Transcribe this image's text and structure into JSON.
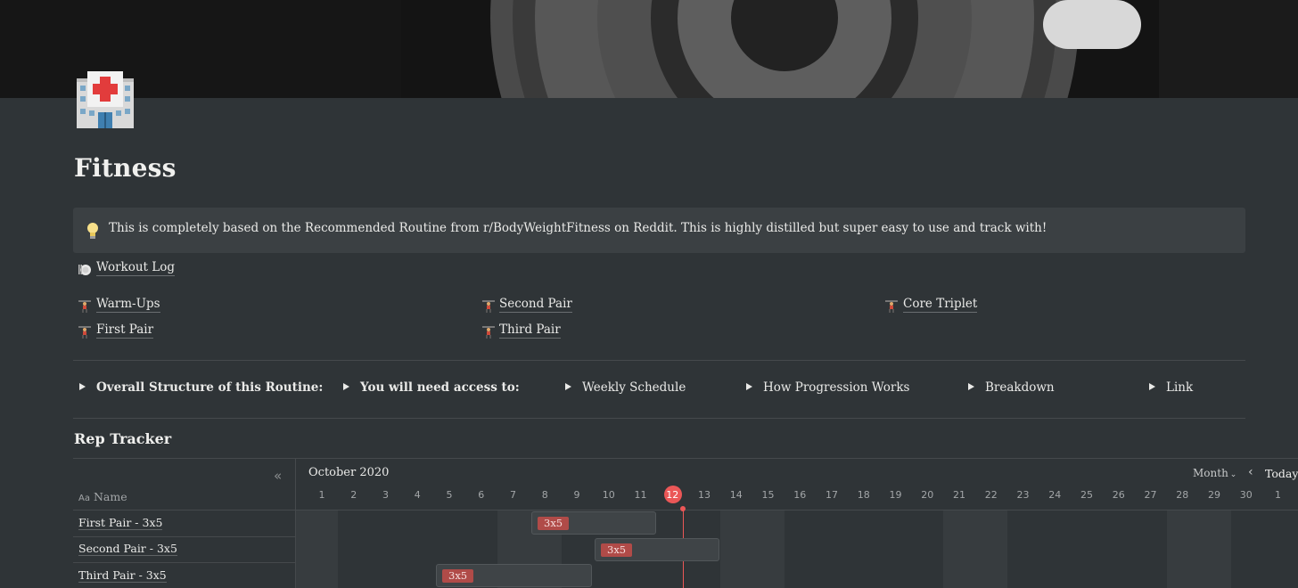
{
  "page": {
    "title": "Fitness",
    "callout": "This is completely based on the Recommended Routine from  r/BodyWeightFitness on Reddit. This is highly distilled but super easy to use and track with!"
  },
  "links": {
    "workout_log": "Workout Log",
    "warm_ups": "Warm-Ups",
    "first_pair": "First Pair",
    "second_pair": "Second Pair",
    "third_pair": "Third Pair",
    "core_triplet": "Core Triplet"
  },
  "toggles": [
    "Overall Structure of this Routine:",
    "You will need access to:",
    "Weekly Schedule",
    "How Progression Works",
    "Breakdown",
    "Link"
  ],
  "tracker": {
    "title": "Rep Tracker",
    "name_header": "Name",
    "name_header_icon": "Aa",
    "month_label": "October 2020",
    "view": "Month",
    "today_button": "Today",
    "days": [
      "1",
      "2",
      "3",
      "4",
      "5",
      "6",
      "7",
      "8",
      "9",
      "10",
      "11",
      "12",
      "13",
      "14",
      "15",
      "16",
      "17",
      "18",
      "19",
      "20",
      "21",
      "22",
      "23",
      "24",
      "25",
      "26",
      "27",
      "28",
      "29",
      "30",
      "1"
    ],
    "today_index": 11,
    "rows": [
      {
        "name": "First Pair - 3x5",
        "tag": "3x5"
      },
      {
        "name": "Second Pair - 3x5",
        "tag": "3x5"
      },
      {
        "name": "Third Pair - 3x5",
        "tag": "3x5"
      }
    ]
  },
  "colors": {
    "background": "#2f3437",
    "accent_red": "#eb5757",
    "tag_red": "#b04b48"
  },
  "icons": {
    "page_icon": "hospital-icon",
    "callout_icon": "lightbulb-icon",
    "workout_log_icon": "plate-icon",
    "exercise_icon": "weightlifter-icon"
  }
}
